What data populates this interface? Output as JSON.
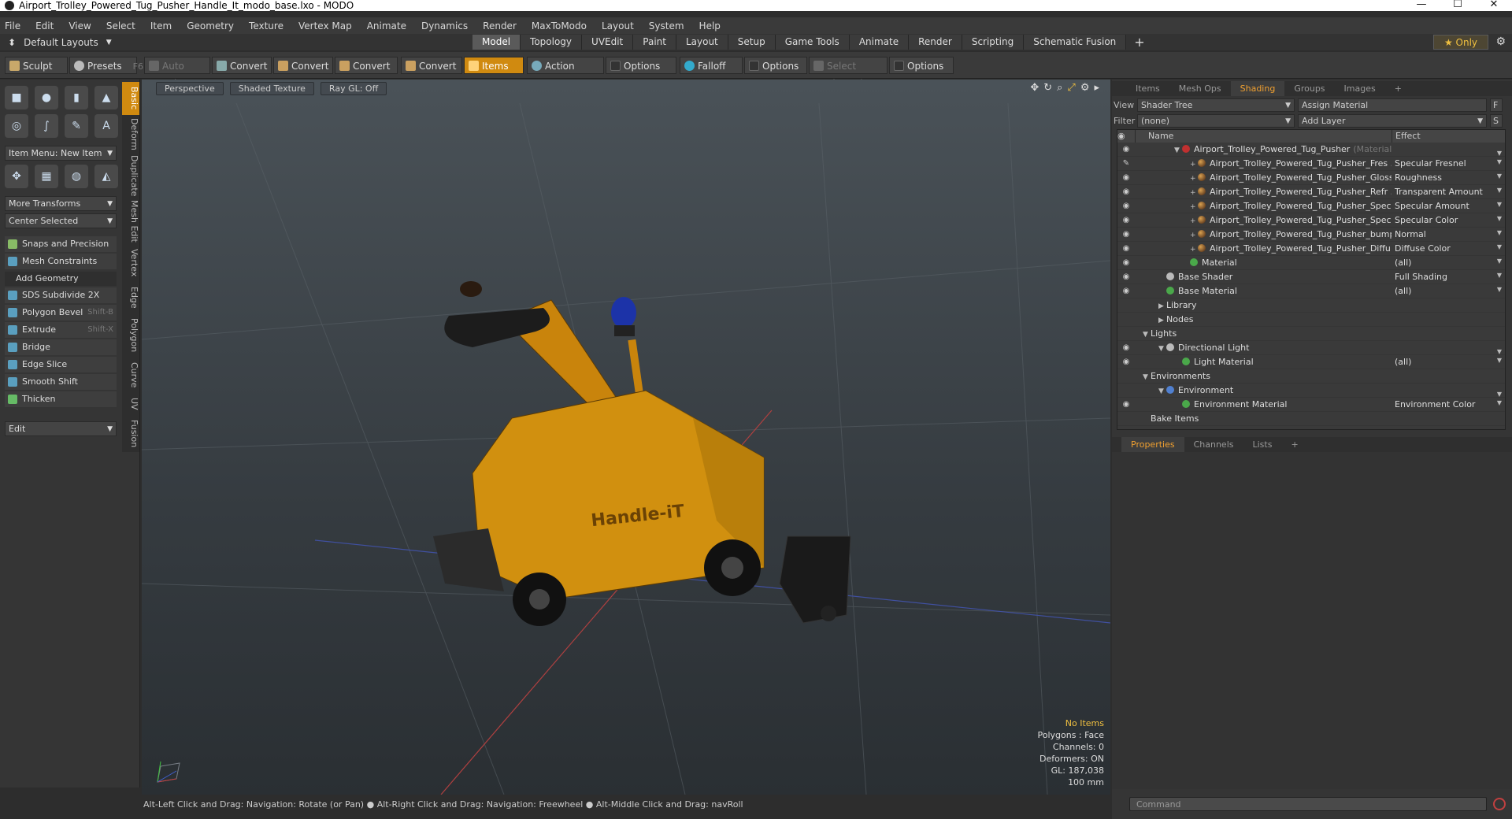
{
  "window": {
    "title": "Airport_Trolley_Powered_Tug_Pusher_Handle_It_modo_base.lxo - MODO",
    "minimize": "—",
    "maximize": "☐",
    "close": "✕"
  },
  "menu": [
    "File",
    "Edit",
    "View",
    "Select",
    "Item",
    "Geometry",
    "Texture",
    "Vertex Map",
    "Animate",
    "Dynamics",
    "Render",
    "MaxToModo",
    "Layout",
    "System",
    "Help"
  ],
  "layouts": {
    "selector": "Default Layouts",
    "tabs": [
      "Model",
      "Topology",
      "UVEdit",
      "Paint",
      "Layout",
      "Setup",
      "Game Tools",
      "Animate",
      "Render",
      "Scripting",
      "Schematic Fusion"
    ],
    "active": "Model",
    "only_label": "★  Only"
  },
  "toolbar": {
    "sculpt": "Sculpt",
    "presets": "Presets",
    "presets_key": "F6",
    "auto_select": "Auto Select",
    "convert1": "Convert",
    "convert2": "Convert",
    "convert3": "Convert",
    "convert4": "Convert",
    "items": "Items",
    "action_center": "Action Center",
    "options1": "Options",
    "falloff": "Falloff",
    "options2": "Options",
    "select_through": "Select Through",
    "options3": "Options"
  },
  "left": {
    "vtabs": [
      "Basic",
      "Deform",
      "Duplicate",
      "Mesh Edit",
      "Vertex",
      "Edge",
      "Polygon",
      "Curve",
      "UV",
      "Fusion"
    ],
    "item_menu": "Item Menu: New Item",
    "more_transforms": "More Transforms",
    "center_selected": "Center Selected",
    "snaps": "Snaps and Precision",
    "mesh_constraints": "Mesh Constraints",
    "add_geometry": "Add Geometry",
    "tools": [
      {
        "label": "SDS Subdivide 2X",
        "key": ""
      },
      {
        "label": "Polygon Bevel",
        "key": "Shift-B"
      },
      {
        "label": "Extrude",
        "key": "Shift-X"
      },
      {
        "label": "Bridge",
        "key": ""
      },
      {
        "label": "Edge Slice",
        "key": ""
      },
      {
        "label": "Smooth Shift",
        "key": ""
      },
      {
        "label": "Thicken",
        "key": ""
      }
    ],
    "edit": "Edit"
  },
  "viewport": {
    "perspective": "Perspective",
    "shaded": "Shaded Texture",
    "raygl": "Ray GL: Off",
    "model_label": "Handle-iT",
    "stats": {
      "no_items": "No Items",
      "polygons": "Polygons : Face",
      "channels": "Channels: 0",
      "deformers": "Deformers: ON",
      "gl": "GL: 187,038",
      "size": "100 mm"
    }
  },
  "status": "Alt-Left Click and Drag: Navigation: Rotate (or Pan) ● Alt-Right Click and Drag: Navigation: Freewheel ● Alt-Middle Click and Drag: navRoll",
  "right": {
    "tabs": [
      "Items",
      "Mesh Ops",
      "Shading",
      "Groups",
      "Images"
    ],
    "active": "Shading",
    "view_label": "View",
    "view_value": "Shader Tree",
    "assign_material": "Assign Material",
    "filter_label": "Filter",
    "filter_value": "(none)",
    "add_layer": "Add Layer",
    "f_btn": "F",
    "s_btn": "S",
    "col_name": "Name",
    "col_effect": "Effect",
    "rows": [
      {
        "indent": 4,
        "tw": "▼",
        "dot": "red",
        "name": "Airport_Trolley_Powered_Tug_Pusher",
        "sub": "(Material)",
        "effect": "",
        "eye": "◉"
      },
      {
        "indent": 6,
        "tw": "+",
        "dot": "ball",
        "name": "Airport_Trolley_Powered_Tug_Pusher_Fres ...",
        "sub": "",
        "effect": "Specular Fresnel",
        "eye": "✎"
      },
      {
        "indent": 6,
        "tw": "+",
        "dot": "ball",
        "name": "Airport_Trolley_Powered_Tug_Pusher_Gloss ...",
        "sub": "",
        "effect": "Roughness",
        "eye": "◉"
      },
      {
        "indent": 6,
        "tw": "+",
        "dot": "ball",
        "name": "Airport_Trolley_Powered_Tug_Pusher_Refr ...",
        "sub": "",
        "effect": "Transparent Amount",
        "eye": "◉"
      },
      {
        "indent": 6,
        "tw": "+",
        "dot": "ball",
        "name": "Airport_Trolley_Powered_Tug_Pusher_Spec ...",
        "sub": "",
        "effect": "Specular Amount",
        "eye": "◉"
      },
      {
        "indent": 6,
        "tw": "+",
        "dot": "ball",
        "name": "Airport_Trolley_Powered_Tug_Pusher_Spec ...",
        "sub": "",
        "effect": "Specular Color",
        "eye": "◉"
      },
      {
        "indent": 6,
        "tw": "+",
        "dot": "ball",
        "name": "Airport_Trolley_Powered_Tug_Pusher_bump...",
        "sub": "",
        "effect": "Normal",
        "eye": "◉"
      },
      {
        "indent": 6,
        "tw": "+",
        "dot": "ball",
        "name": "Airport_Trolley_Powered_Tug_Pusher_Diffu ...",
        "sub": "",
        "effect": "Diffuse Color",
        "eye": "◉"
      },
      {
        "indent": 5,
        "tw": "",
        "dot": "green",
        "name": "Material",
        "sub": "",
        "effect": "(all)",
        "eye": "◉"
      },
      {
        "indent": 2,
        "tw": "",
        "dot": "gray",
        "name": "Base Shader",
        "sub": "",
        "effect": "Full Shading",
        "eye": "◉"
      },
      {
        "indent": 2,
        "tw": "",
        "dot": "green",
        "name": "Base Material",
        "sub": "",
        "effect": "(all)",
        "eye": "◉"
      },
      {
        "indent": 2,
        "tw": "▶",
        "dot": "",
        "name": "Library",
        "sub": "",
        "effect": "",
        "eye": ""
      },
      {
        "indent": 2,
        "tw": "▶",
        "dot": "",
        "name": "Nodes",
        "sub": "",
        "effect": "",
        "eye": ""
      },
      {
        "indent": 0,
        "tw": "▼",
        "dot": "",
        "name": "Lights",
        "sub": "",
        "effect": "",
        "eye": ""
      },
      {
        "indent": 2,
        "tw": "▼",
        "dot": "gray",
        "name": "Directional Light",
        "sub": "",
        "effect": "",
        "eye": "◉"
      },
      {
        "indent": 4,
        "tw": "",
        "dot": "green",
        "name": "Light Material",
        "sub": "",
        "effect": "(all)",
        "eye": "◉"
      },
      {
        "indent": 0,
        "tw": "▼",
        "dot": "",
        "name": "Environments",
        "sub": "",
        "effect": "",
        "eye": ""
      },
      {
        "indent": 2,
        "tw": "▼",
        "dot": "blue",
        "name": "Environment",
        "sub": "",
        "effect": "",
        "eye": ""
      },
      {
        "indent": 4,
        "tw": "",
        "dot": "green",
        "name": "Environment Material",
        "sub": "",
        "effect": "Environment Color",
        "eye": "◉"
      },
      {
        "indent": 0,
        "tw": "",
        "dot": "",
        "name": "Bake Items",
        "sub": "",
        "effect": "",
        "eye": ""
      }
    ],
    "props_tabs": [
      "Properties",
      "Channels",
      "Lists"
    ],
    "props_active": "Properties",
    "command_placeholder": "Command"
  }
}
